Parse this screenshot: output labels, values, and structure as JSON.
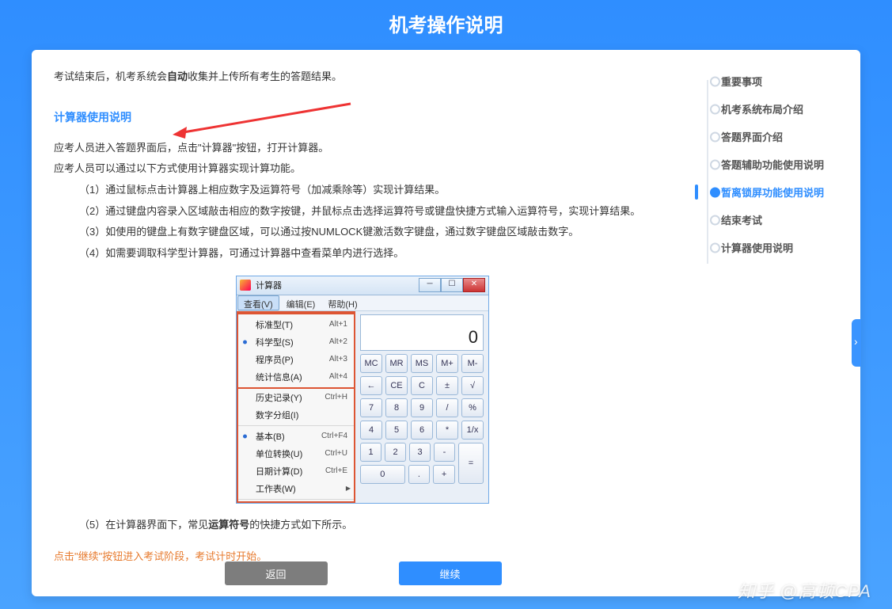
{
  "page_title": "机考操作说明",
  "intro_line1_pre": "考试结束后，机考系统会",
  "intro_line1_bold": "自动",
  "intro_line1_post": "收集并上传所有考生的答题结果。",
  "section_title": "计算器使用说明",
  "para1": "应考人员进入答题界面后，点击\"计算器\"按钮，打开计算器。",
  "para2": "应考人员可以通过以下方式使用计算器实现计算功能。",
  "bullets": {
    "b1": "（1）通过鼠标点击计算器上相应数字及运算符号（加减乘除等）实现计算结果。",
    "b2": "（2）通过键盘内容录入区域敲击相应的数字按键，并鼠标点击选择运算符号或键盘快捷方式输入运算符号，实现计算结果。",
    "b3": "（3）如使用的键盘上有数字键盘区域，可以通过按NUMLOCK键激活数字键盘，通过数字键盘区域敲击数字。",
    "b4": "（4）如需要调取科学型计算器，可通过计算器中查看菜单内进行选择。",
    "b5_pre": "（5）在计算器界面下，常见",
    "b5_bold": "运算符号",
    "b5_post": "的快捷方式如下所示。"
  },
  "calc": {
    "title": "计算器",
    "menu": {
      "view": "查看(V)",
      "edit": "编辑(E)",
      "help": "帮助(H)"
    },
    "display": "0",
    "menu_items": {
      "standard": "标准型(T)",
      "standard_sc": "Alt+1",
      "scientific": "科学型(S)",
      "scientific_sc": "Alt+2",
      "programmer": "程序员(P)",
      "programmer_sc": "Alt+3",
      "statistics": "统计信息(A)",
      "statistics_sc": "Alt+4",
      "history": "历史记录(Y)",
      "history_sc": "Ctrl+H",
      "digit_group": "数字分组(I)",
      "basic": "基本(B)",
      "basic_sc": "Ctrl+F4",
      "unit": "单位转换(U)",
      "unit_sc": "Ctrl+U",
      "date": "日期计算(D)",
      "date_sc": "Ctrl+E",
      "worksheet": "工作表(W)"
    },
    "mem": {
      "mc": "MC",
      "mr": "MR",
      "ms": "MS",
      "mp": "M+",
      "mm": "M-"
    },
    "row2": {
      "bk": "←",
      "ce": "CE",
      "c": "C",
      "pm": "±",
      "sqrt": "√"
    },
    "keys": {
      "k7": "7",
      "k8": "8",
      "k9": "9",
      "div": "/",
      "pct": "%",
      "k4": "4",
      "k5": "5",
      "k6": "6",
      "mul": "*",
      "inv": "1/x",
      "k1": "1",
      "k2": "2",
      "k3": "3",
      "sub": "-",
      "eq": "=",
      "k0": "0",
      "dot": ".",
      "add": "+"
    }
  },
  "warning": "点击\"继续\"按钮进入考试阶段，考试计时开始。",
  "buttons": {
    "back": "返回",
    "continue": "继续"
  },
  "nav": {
    "n1": "重要事项",
    "n2": "机考系统布局介绍",
    "n3": "答题界面介绍",
    "n4": "答题辅助功能使用说明",
    "n5": "暂离锁屏功能使用说明",
    "n6": "结束考试",
    "n7": "计算器使用说明"
  },
  "watermark": "知乎 @高顿CPA"
}
